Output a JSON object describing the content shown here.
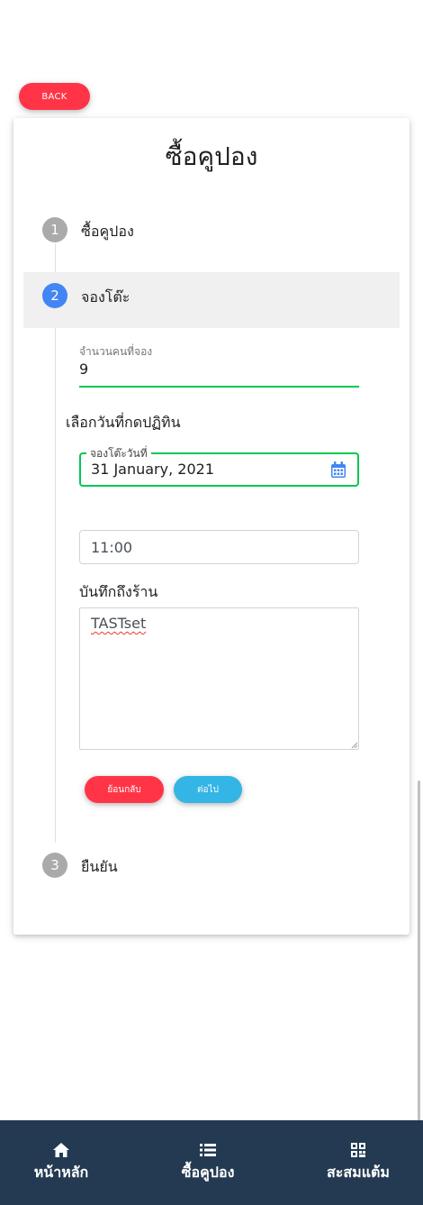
{
  "header": {
    "back_label": "BACK"
  },
  "card": {
    "title": "ซื้อคูปอง"
  },
  "steps": [
    {
      "number": "1",
      "label": "ซื้อคูปอง"
    },
    {
      "number": "2",
      "label": "จองโต๊ะ"
    },
    {
      "number": "3",
      "label": "ยืนยัน"
    }
  ],
  "form": {
    "count_label": "จำนวนคนที่จอง",
    "count_value": "9",
    "date_section_label": "เลือกวันที่กดปฏิทิน",
    "date_legend": "จองโต๊ะวันที่",
    "date_value": "31 January, 2021",
    "time_value": "11:00",
    "note_label": "บันทึกถึงร้าน",
    "note_value": "TASTset",
    "back_button": "ย้อนกลับ",
    "next_button": "ต่อไป"
  },
  "colors": {
    "accent_green": "#00c851",
    "danger": "#ff3547",
    "info": "#33b5e5",
    "primary": "#4285f4",
    "nav_bg": "#243a52"
  },
  "bottom_nav": [
    {
      "label": "หน้าหลัก",
      "icon": "home-icon"
    },
    {
      "label": "ซื้อคูปอง",
      "icon": "list-icon"
    },
    {
      "label": "สะสมแต้ม",
      "icon": "qrcode-icon"
    }
  ]
}
